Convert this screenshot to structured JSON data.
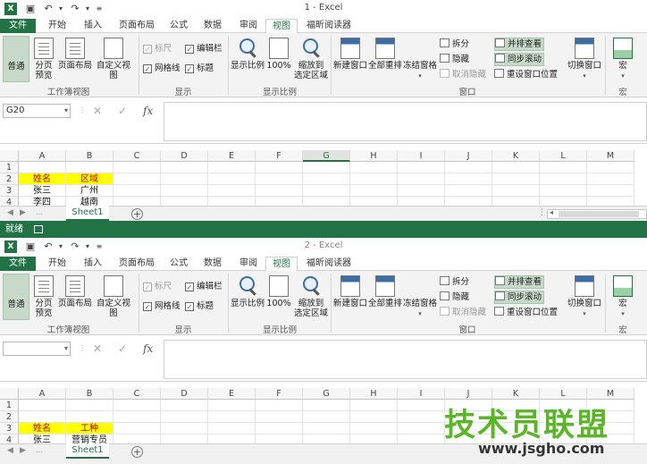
{
  "windows": [
    {
      "title": "1 - Excel",
      "name_box": "G20",
      "selected_column": "G",
      "tabs": [
        "文件",
        "开始",
        "插入",
        "页面布局",
        "公式",
        "数据",
        "审阅",
        "视图",
        "福昕阅读器"
      ],
      "active_tab_index": 7,
      "rows": [
        {
          "num": "1",
          "a": "",
          "b": ""
        },
        {
          "num": "2",
          "a": "姓名",
          "b": "区域"
        },
        {
          "num": "3",
          "a": "张三",
          "b": "广州"
        },
        {
          "num": "4",
          "a": "李四",
          "b": "越南"
        }
      ],
      "highlight_row": 1,
      "sheet_tab": "Sheet1",
      "status": "就绪"
    },
    {
      "title": "2 - Excel",
      "name_box": "",
      "selected_column": "",
      "tabs": [
        "文件",
        "开始",
        "插入",
        "页面布局",
        "公式",
        "数据",
        "审阅",
        "视图",
        "福昕阅读器"
      ],
      "active_tab_index": 7,
      "rows": [
        {
          "num": "1",
          "a": "",
          "b": ""
        },
        {
          "num": "2",
          "a": "",
          "b": ""
        },
        {
          "num": "3",
          "a": "姓名",
          "b": "工种"
        },
        {
          "num": "4",
          "a": "张三",
          "b": "营销专员"
        }
      ],
      "highlight_row": 2,
      "sheet_tab": "Sheet1"
    }
  ],
  "ribbon": {
    "workbook_views": {
      "normal": "普通",
      "page_break": "分页\n预览",
      "page_layout": "页面布局",
      "custom_views": "自定义视图",
      "group": "工作簿视图"
    },
    "show": {
      "ruler": "标尺",
      "formula_bar": "编辑栏",
      "gridlines": "网格线",
      "headings": "标题",
      "group": "显示"
    },
    "zoom": {
      "zoom": "显示比例",
      "hundred": "100%",
      "to_selection": "缩放到\n选定区域",
      "group": "显示比例"
    },
    "window": {
      "new_window": "新建窗口",
      "arrange_all": "全部重排",
      "freeze": "冻结窗格",
      "split": "拆分",
      "hide": "隐藏",
      "unhide": "取消隐藏",
      "side_by_side": "并排查看",
      "sync_scroll": "同步滚动",
      "reset_position": "重设窗口位置",
      "switch": "切换窗口",
      "group": "窗口"
    },
    "macros": {
      "macros": "宏",
      "group": "宏"
    }
  },
  "columns": [
    "A",
    "B",
    "C",
    "D",
    "E",
    "F",
    "G",
    "H",
    "I",
    "J",
    "K",
    "L",
    "M"
  ],
  "watermark": {
    "title": "技术员联盟",
    "url": "www.jsgho.com"
  },
  "colors": {
    "excel_green": "#217346",
    "highlight_yellow": "#ffff00",
    "highlight_text": "#c00000"
  }
}
